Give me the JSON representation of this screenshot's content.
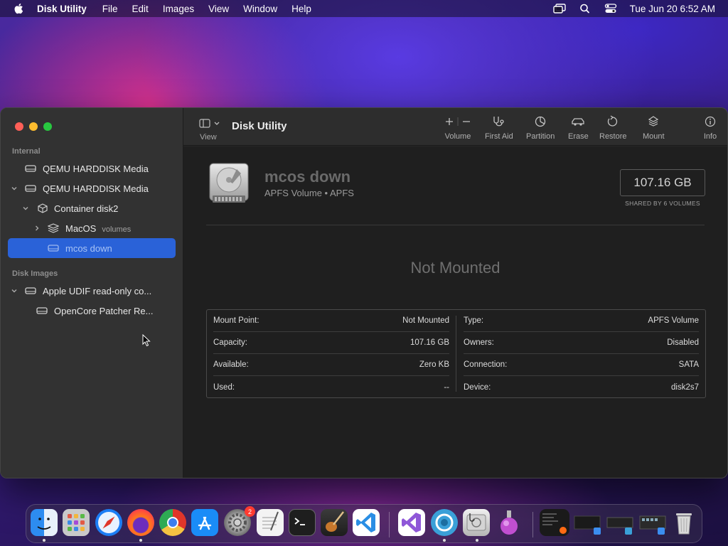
{
  "menubar": {
    "app_name": "Disk Utility",
    "items": [
      "File",
      "Edit",
      "Images",
      "View",
      "Window",
      "Help"
    ],
    "clock": "Tue Jun 20  6:52 AM",
    "status_icons": [
      "screen-mirroring-icon",
      "spotlight-search-icon",
      "control-center-icon"
    ]
  },
  "sidebar": {
    "sections": [
      {
        "label": "Internal"
      },
      {
        "label": "Disk Images"
      }
    ],
    "items": [
      {
        "label": "QEMU HARDDISK Media",
        "icon": "hard-disk-icon",
        "expanded": false
      },
      {
        "label": "QEMU HARDDISK Media",
        "icon": "hard-disk-icon",
        "expanded": true
      },
      {
        "label": "Container disk2",
        "icon": "container-icon",
        "expanded": true
      },
      {
        "label": "MacOS",
        "sublabel": "volumes",
        "icon": "volume-stack-icon",
        "expanded": false
      },
      {
        "label": "mcos down",
        "icon": "volume-icon",
        "selected": true
      },
      {
        "label": "Apple UDIF read-only co...",
        "icon": "hard-disk-icon",
        "expanded": true
      },
      {
        "label": "OpenCore Patcher Re...",
        "icon": "hard-disk-icon"
      }
    ]
  },
  "toolbar": {
    "view_label": "View",
    "title": "Disk Utility",
    "buttons": [
      {
        "label": "Volume",
        "icon": "add-remove-volume-icon"
      },
      {
        "label": "First Aid",
        "icon": "stethoscope-icon"
      },
      {
        "label": "Partition",
        "icon": "pie-chart-icon"
      },
      {
        "label": "Erase",
        "icon": "eraser-car-icon"
      },
      {
        "label": "Restore",
        "icon": "restore-icon"
      },
      {
        "label": "Mount",
        "icon": "mount-icon"
      },
      {
        "label": "Info",
        "icon": "info-icon"
      }
    ]
  },
  "volume": {
    "name": "mcos down",
    "subtitle": "APFS Volume • APFS",
    "size": "107.16 GB",
    "size_caption": "SHARED BY 6 VOLUMES",
    "status": "Not Mounted"
  },
  "info": {
    "left": [
      {
        "key": "Mount Point:",
        "value": "Not Mounted"
      },
      {
        "key": "Capacity:",
        "value": "107.16 GB"
      },
      {
        "key": "Available:",
        "value": "Zero KB"
      },
      {
        "key": "Used:",
        "value": "--"
      }
    ],
    "right": [
      {
        "key": "Type:",
        "value": "APFS Volume"
      },
      {
        "key": "Owners:",
        "value": "Disabled"
      },
      {
        "key": "Connection:",
        "value": "SATA"
      },
      {
        "key": "Device:",
        "value": "disk2s7"
      }
    ]
  },
  "dock": {
    "apps": [
      {
        "name": "finder-icon",
        "color": "#3d8ef0"
      },
      {
        "name": "launchpad-icon",
        "color": "#c9c9c9"
      },
      {
        "name": "safari-icon",
        "color": "#1c7ef5"
      },
      {
        "name": "firefox-icon",
        "color": "#ff6a13"
      },
      {
        "name": "chrome-icon",
        "color": "#e8e8e8"
      },
      {
        "name": "app-store-icon",
        "color": "#1a8cf7"
      },
      {
        "name": "system-settings-icon",
        "color": "#8a8a8a",
        "badge": "2"
      },
      {
        "name": "textedit-icon",
        "color": "#efefef"
      },
      {
        "name": "terminal-icon",
        "color": "#1e1e1e"
      },
      {
        "name": "garageband-icon",
        "color": "#6a4426"
      },
      {
        "name": "vscode-icon",
        "color": "#ffffff"
      },
      {
        "name": "visual-studio-icon",
        "color": "#ffffff"
      },
      {
        "name": "opencore-icon",
        "color": "#3aa0d8"
      },
      {
        "name": "disk-utility-icon",
        "color": "#e0e0e0"
      },
      {
        "name": "unknown-flask-icon",
        "color": "#c04fd0"
      }
    ]
  }
}
